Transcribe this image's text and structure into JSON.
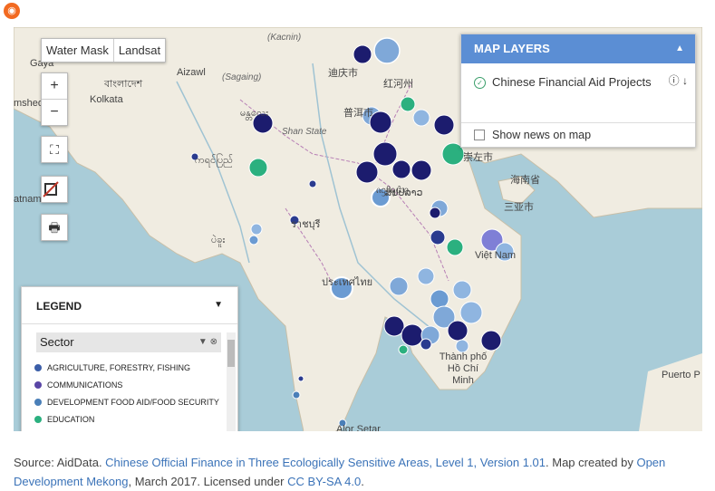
{
  "rss_icon": "rss-icon",
  "basemap": {
    "water_mask": "Water Mask",
    "landsat": "Landsat"
  },
  "zoom": {
    "in": "+",
    "out": "−"
  },
  "tools": {
    "fullscreen_icon": "fullscreen-icon",
    "no_layer_icon": "no-layer-icon",
    "print_icon": "print-icon"
  },
  "places": [
    {
      "name": "Gaya"
    },
    {
      "name": "Aizawl"
    },
    {
      "name": "(Sagaing)"
    },
    {
      "name": "(Kacnin)"
    },
    {
      "name": "বাংলাদেশ"
    },
    {
      "name": "Kolkata"
    },
    {
      "name": "mshedi"
    },
    {
      "name": "မန္တလေး"
    },
    {
      "name": "Shan State"
    },
    {
      "name": "迪庆市"
    },
    {
      "name": "红河州"
    },
    {
      "name": "普洱市"
    },
    {
      "name": "崇左市"
    },
    {
      "name": "海南省"
    },
    {
      "name": "三亚市"
    },
    {
      "name": "ကရင်ပြည်"
    },
    {
      "name": "atnam"
    },
    {
      "name": "ᦵᦋᦲᧂᦺᦉ"
    },
    {
      "name": "ပဲခူး"
    },
    {
      "name": "ราชบุรี"
    },
    {
      "name": "ประเทศไทย"
    },
    {
      "name": "ສປປລາວ"
    },
    {
      "name": "Việt Nam"
    },
    {
      "name": "Thành phố Hồ Chí Minh"
    },
    {
      "name": "Puerto P"
    },
    {
      "name": "Alor Setar"
    }
  ],
  "map_layers": {
    "title": "MAP LAYERS",
    "layer": "Chinese Financial Aid Projects",
    "show_news": "Show news on map"
  },
  "legend": {
    "title": "LEGEND",
    "sector_label": "Sector",
    "items": [
      {
        "label": "AGRICULTURE, FORESTRY, FISHING",
        "color": "#3b5ea8"
      },
      {
        "label": "COMMUNICATIONS",
        "color": "#5a46a6"
      },
      {
        "label": "DEVELOPMENT FOOD AID/FOOD SECURITY",
        "color": "#4a7fb8"
      },
      {
        "label": "EDUCATION",
        "color": "#2bb07f"
      }
    ]
  },
  "caption": {
    "prefix": "Source: AidData. ",
    "dataset_link": "Chinese Official Finance in Three Ecologically Sensitive Areas, Level 1, Version 1.01",
    "mid": ". Map created by ",
    "author_link": "Open Development Mekong",
    "date": ", March 2017. Licensed under ",
    "license_link": "CC BY-SA 4.0",
    "suffix": "."
  },
  "colors": {
    "dark_navy": "#1c1c6e",
    "navy": "#2a3b8f",
    "steel": "#6b9bd2",
    "light": "#8fb5e0",
    "green": "#2bb07f",
    "purple": "#7f7fd6"
  }
}
